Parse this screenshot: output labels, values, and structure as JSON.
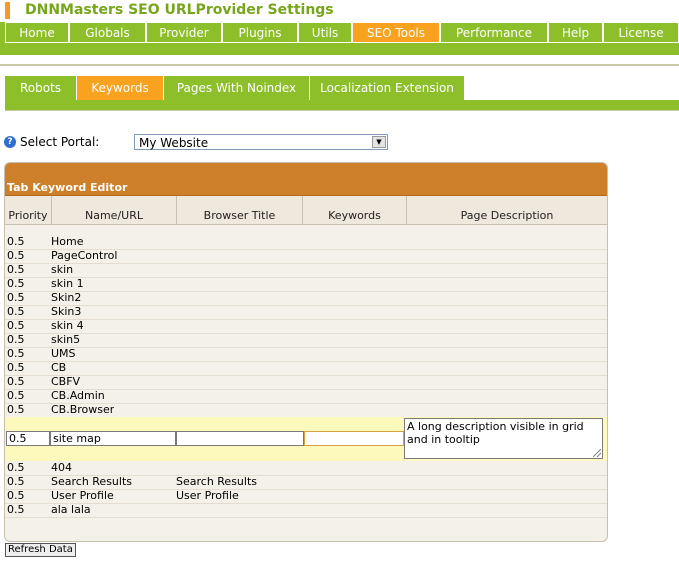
{
  "header": {
    "title": "DNNMasters SEO URLProvider Settings"
  },
  "main_menu": {
    "items": [
      {
        "label": "Home",
        "active": false
      },
      {
        "label": "Globals",
        "active": false
      },
      {
        "label": "Provider",
        "active": false
      },
      {
        "label": "Plugins",
        "active": false
      },
      {
        "label": "Utils",
        "active": false
      },
      {
        "label": "SEO Tools",
        "active": true
      },
      {
        "label": "Performance",
        "active": false
      },
      {
        "label": "Help",
        "active": false
      },
      {
        "label": "License",
        "active": false
      }
    ]
  },
  "sub_menu": {
    "items": [
      {
        "label": "Robots",
        "active": false
      },
      {
        "label": "Keywords",
        "active": true
      },
      {
        "label": "Pages With Noindex",
        "active": false
      },
      {
        "label": "Localization Extension",
        "active": false
      }
    ]
  },
  "portal": {
    "label": "Select Portal:",
    "selected": "My Website"
  },
  "grid": {
    "title": "Tab Keyword Editor",
    "columns": [
      "Priority",
      "Name/URL",
      "Browser Title",
      "Keywords",
      "Page Description"
    ],
    "rows_before_edit": [
      {
        "priority": "0.5",
        "name": "Home",
        "title": ""
      },
      {
        "priority": "0.5",
        "name": "PageControl",
        "title": ""
      },
      {
        "priority": "0.5",
        "name": "skin",
        "title": ""
      },
      {
        "priority": "0.5",
        "name": "skin 1",
        "title": ""
      },
      {
        "priority": "0.5",
        "name": "Skin2",
        "title": ""
      },
      {
        "priority": "0.5",
        "name": "Skin3",
        "title": ""
      },
      {
        "priority": "0.5",
        "name": "skin 4",
        "title": ""
      },
      {
        "priority": "0.5",
        "name": "skin5",
        "title": ""
      },
      {
        "priority": "0.5",
        "name": "UMS",
        "title": ""
      },
      {
        "priority": "0.5",
        "name": "CB",
        "title": ""
      },
      {
        "priority": "0.5",
        "name": "CBFV",
        "title": ""
      },
      {
        "priority": "0.5",
        "name": "CB.Admin",
        "title": ""
      },
      {
        "priority": "0.5",
        "name": "CB.Browser",
        "title": ""
      }
    ],
    "edit_row": {
      "priority": "0.5",
      "name": "site map",
      "title": "",
      "keywords": "",
      "description": "A long description visible in grid and in tooltip"
    },
    "rows_after_edit": [
      {
        "priority": "0.5",
        "name": "404",
        "title": ""
      },
      {
        "priority": "0.5",
        "name": "Search Results",
        "title": "Search Results"
      },
      {
        "priority": "0.5",
        "name": "User Profile",
        "title": "User Profile"
      },
      {
        "priority": "0.5",
        "name": "ala lala",
        "title": ""
      }
    ]
  },
  "footer": {
    "refresh_label": "Refresh Data"
  }
}
